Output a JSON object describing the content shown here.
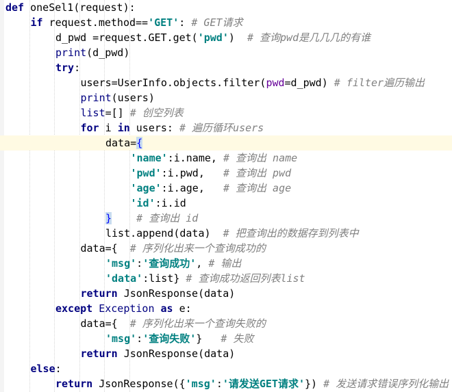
{
  "editor": {
    "lines": [
      {
        "indent": 0,
        "tokens": [
          {
            "t": "def",
            "c": "kw"
          },
          {
            "t": " oneSel1(request):"
          }
        ]
      },
      {
        "indent": 1,
        "tokens": [
          {
            "t": "if",
            "c": "kw"
          },
          {
            "t": " request.method=="
          },
          {
            "t": "'GET'",
            "c": "str"
          },
          {
            "t": ": "
          },
          {
            "t": "# GET请求",
            "c": "cmt"
          }
        ]
      },
      {
        "indent": 2,
        "tokens": [
          {
            "t": "d_pwd =request.GET.get("
          },
          {
            "t": "'pwd'",
            "c": "str"
          },
          {
            "t": ")  "
          },
          {
            "t": "# 查询pwd是几几几的有谁",
            "c": "cmt"
          }
        ]
      },
      {
        "indent": 2,
        "tokens": [
          {
            "t": "print",
            "c": "bi"
          },
          {
            "t": "(d_pwd)"
          }
        ]
      },
      {
        "indent": 2,
        "tokens": [
          {
            "t": "try",
            "c": "kw"
          },
          {
            "t": ":"
          }
        ]
      },
      {
        "indent": 3,
        "tokens": [
          {
            "t": "users=UserInfo.objects.filter("
          },
          {
            "t": "pwd",
            "c": "param"
          },
          {
            "t": "=d_pwd) "
          },
          {
            "t": "# filter遍历输出",
            "c": "cmt"
          }
        ]
      },
      {
        "indent": 3,
        "tokens": [
          {
            "t": "print",
            "c": "bi"
          },
          {
            "t": "(users)"
          }
        ]
      },
      {
        "indent": 3,
        "tokens": [
          {
            "t": "list",
            "c": "bi"
          },
          {
            "t": "=[] "
          },
          {
            "t": "# 创空列表",
            "c": "cmt"
          }
        ]
      },
      {
        "indent": 3,
        "tokens": [
          {
            "t": "for",
            "c": "kw"
          },
          {
            "t": " i "
          },
          {
            "t": "in",
            "c": "kw"
          },
          {
            "t": " users: "
          },
          {
            "t": "# 遍历循环users",
            "c": "cmt"
          }
        ]
      },
      {
        "indent": 4,
        "current": true,
        "tokens": [
          {
            "t": "data="
          },
          {
            "t": "{",
            "c": "match"
          }
        ]
      },
      {
        "indent": 5,
        "tokens": [
          {
            "t": "'name'",
            "c": "str"
          },
          {
            "t": ":i.name, "
          },
          {
            "t": "# 查询出 name",
            "c": "cmt"
          }
        ]
      },
      {
        "indent": 5,
        "tokens": [
          {
            "t": "'pwd'",
            "c": "str"
          },
          {
            "t": ":i.pwd,   "
          },
          {
            "t": "# 查询出 pwd",
            "c": "cmt"
          }
        ]
      },
      {
        "indent": 5,
        "tokens": [
          {
            "t": "'age'",
            "c": "str"
          },
          {
            "t": ":i.age,   "
          },
          {
            "t": "# 查询出 age",
            "c": "cmt"
          }
        ]
      },
      {
        "indent": 5,
        "tokens": [
          {
            "t": "'id'",
            "c": "str"
          },
          {
            "t": ":i.id"
          }
        ]
      },
      {
        "indent": 4,
        "tokens": [
          {
            "t": "}",
            "c": "match"
          },
          {
            "t": "    "
          },
          {
            "t": "# 查询出 id",
            "c": "cmt"
          }
        ]
      },
      {
        "indent": 4,
        "tokens": [
          {
            "t": "list.append(data)  "
          },
          {
            "t": "# 把查询出的数据存到列表中",
            "c": "cmt"
          }
        ]
      },
      {
        "indent": 3,
        "tokens": [
          {
            "t": "data={  "
          },
          {
            "t": "# 序列化出来一个查询成功的",
            "c": "cmt"
          }
        ]
      },
      {
        "indent": 4,
        "tokens": [
          {
            "t": "'msg'",
            "c": "str"
          },
          {
            "t": ":"
          },
          {
            "t": "'查询成功'",
            "c": "str"
          },
          {
            "t": ", "
          },
          {
            "t": "# 输出",
            "c": "cmt"
          }
        ]
      },
      {
        "indent": 4,
        "tokens": [
          {
            "t": "'data'",
            "c": "str"
          },
          {
            "t": ":list} "
          },
          {
            "t": "# 查询成功返回列表list",
            "c": "cmt"
          }
        ]
      },
      {
        "indent": 3,
        "tokens": [
          {
            "t": "return",
            "c": "kw"
          },
          {
            "t": " JsonResponse(data)"
          }
        ]
      },
      {
        "indent": 2,
        "tokens": [
          {
            "t": "except",
            "c": "kw"
          },
          {
            "t": " "
          },
          {
            "t": "Exception",
            "c": "bi"
          },
          {
            "t": " "
          },
          {
            "t": "as",
            "c": "kw"
          },
          {
            "t": " e:"
          }
        ]
      },
      {
        "indent": 3,
        "tokens": [
          {
            "t": "data={  "
          },
          {
            "t": "# 序列化出来一个查询失败的",
            "c": "cmt"
          }
        ]
      },
      {
        "indent": 4,
        "tokens": [
          {
            "t": "'msg'",
            "c": "str"
          },
          {
            "t": ":"
          },
          {
            "t": "'查询失败'",
            "c": "str"
          },
          {
            "t": "}   "
          },
          {
            "t": "# 失败",
            "c": "cmt"
          }
        ]
      },
      {
        "indent": 3,
        "tokens": [
          {
            "t": "return",
            "c": "kw"
          },
          {
            "t": " JsonResponse(data)"
          }
        ]
      },
      {
        "indent": 1,
        "tokens": [
          {
            "t": "else",
            "c": "kw"
          },
          {
            "t": ":"
          }
        ]
      },
      {
        "indent": 2,
        "tokens": [
          {
            "t": "return",
            "c": "kw"
          },
          {
            "t": " JsonResponse({"
          },
          {
            "t": "'msg'",
            "c": "str"
          },
          {
            "t": ":"
          },
          {
            "t": "'请发送GET请求'",
            "c": "str"
          },
          {
            "t": "}) "
          },
          {
            "t": "# 发送请求错误序列化输出",
            "c": "cmt"
          }
        ]
      }
    ]
  }
}
